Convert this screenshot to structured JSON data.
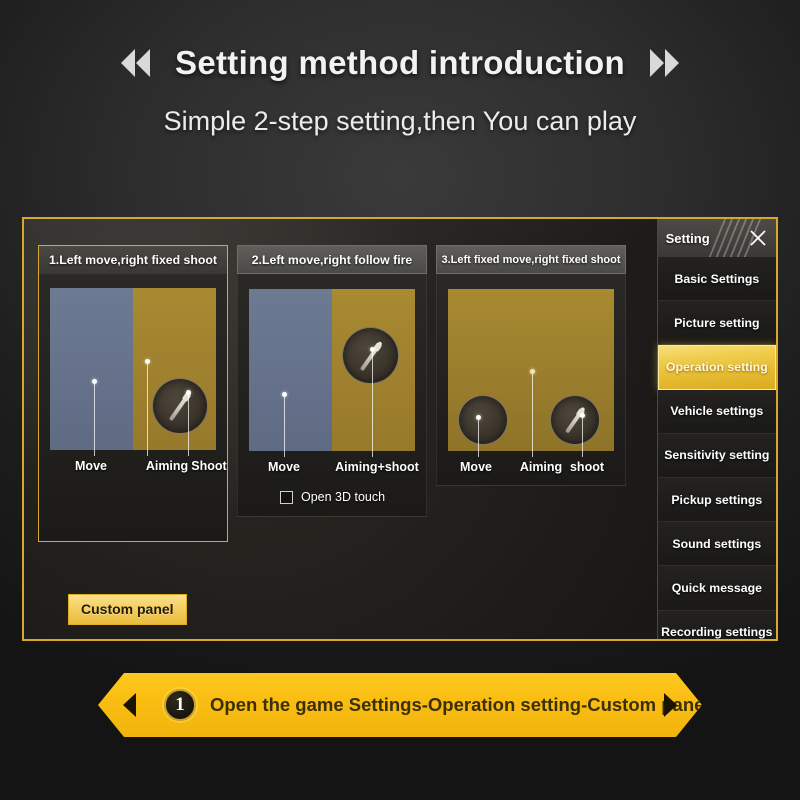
{
  "header": {
    "title": "Setting method introduction",
    "subtitle": "Simple 2-step setting,then You can play",
    "left_chevron": "double-chevron-left-icon",
    "right_chevron": "double-chevron-right-icon"
  },
  "game_panel": {
    "custom_panel_button": "Custom panel",
    "cards": [
      {
        "title": "1.Left move,right fixed shoot",
        "selected": true,
        "labels": [
          "Move",
          "Aiming",
          "Shoot"
        ],
        "checkbox": null
      },
      {
        "title": "2.Left move,right follow fire",
        "selected": false,
        "labels": [
          "Move",
          "Aiming+shoot"
        ],
        "checkbox": {
          "label": "Open 3D touch",
          "checked": false
        }
      },
      {
        "title": "3.Left fixed move,right fixed shoot",
        "selected": false,
        "labels": [
          "Move",
          "Aiming",
          "shoot"
        ],
        "checkbox": null
      }
    ]
  },
  "settings": {
    "header_title": "Setting",
    "close_icon": "close-x-icon",
    "items": [
      {
        "label": "Basic Settings",
        "active": false
      },
      {
        "label": "Picture setting",
        "active": false
      },
      {
        "label": "Operation setting",
        "active": true
      },
      {
        "label": "Vehicle settings",
        "active": false
      },
      {
        "label": "Sensitivity setting",
        "active": false
      },
      {
        "label": "Pickup settings",
        "active": false
      },
      {
        "label": "Sound settings",
        "active": false
      },
      {
        "label": "Quick message",
        "active": false
      },
      {
        "label": "Recording settings",
        "active": false
      }
    ]
  },
  "banner": {
    "step_number": "1",
    "text": "Open the game Settings-Operation setting-Custom panel",
    "left_arrow": "arrow-left-icon",
    "right_arrow": "arrow-right-icon"
  },
  "colors": {
    "gold": "#d8a82a",
    "banner_yellow": "#f9bd12",
    "accent_highlight": "#f0cc4c",
    "move_blue": "#6d7a93",
    "shoot_gold": "#a88a32",
    "background_dark": "#1e1e1e"
  }
}
